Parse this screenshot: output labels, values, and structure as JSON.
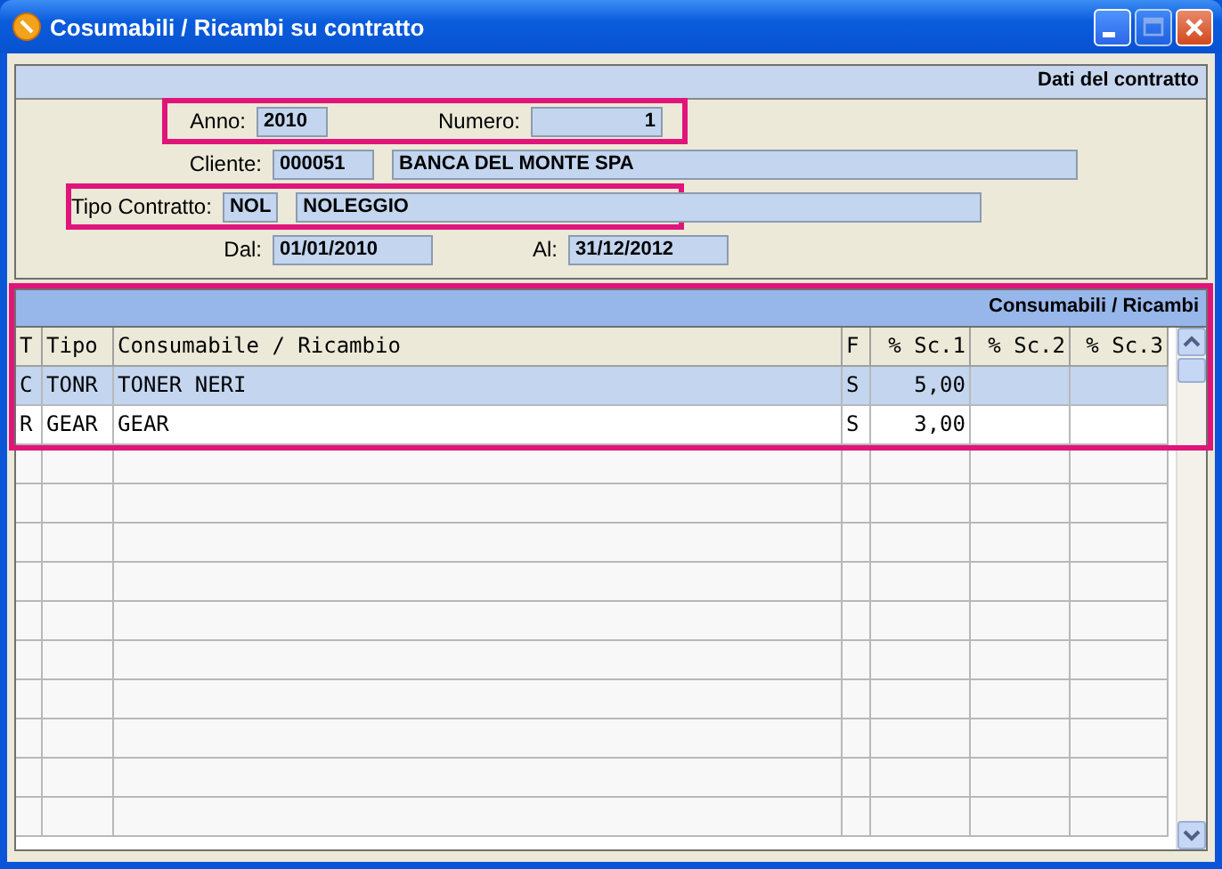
{
  "window": {
    "title": "Cosumabili / Ricambi su contratto"
  },
  "contract_panel": {
    "title": "Dati del contratto",
    "anno": {
      "label": "Anno:",
      "value": "2010"
    },
    "numero": {
      "label": "Numero:",
      "value": "1"
    },
    "cliente": {
      "label": "Cliente:",
      "code": "000051",
      "name": "BANCA DEL MONTE SPA"
    },
    "tipo_contratto": {
      "label": "Tipo Contratto:",
      "code": "NOL",
      "name": "NOLEGGIO"
    },
    "dal": {
      "label": "Dal:",
      "value": "01/01/2010"
    },
    "al": {
      "label": "Al:",
      "value": "31/12/2012"
    },
    "highlighted_rows": {
      "anno_numero": true,
      "tipo_contratto": true
    }
  },
  "grid_panel": {
    "title": "Consumabili / Ricambi",
    "highlighted": true,
    "columns": [
      "T",
      "Tipo",
      "Consumabile / Ricambio",
      "F",
      "% Sc.1",
      "% Sc.2",
      "% Sc.3"
    ],
    "rows": [
      {
        "selected": true,
        "cells": [
          "C",
          "TONR",
          "TONER NERI",
          "S",
          "5,00",
          "",
          ""
        ]
      },
      {
        "selected": false,
        "cells": [
          "R",
          "GEAR",
          "GEAR",
          "S",
          "3,00",
          "",
          ""
        ]
      }
    ]
  }
}
